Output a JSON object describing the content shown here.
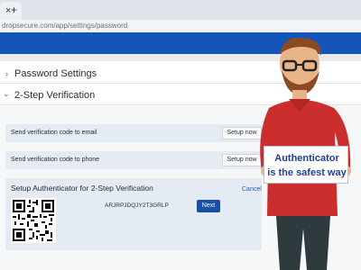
{
  "browser": {
    "tab_close": "×",
    "new_tab": "+",
    "url": "dropsecure.com/app/settings/password"
  },
  "sections": {
    "password_settings": "Password Settings",
    "two_step": "2-Step Verification"
  },
  "verification": {
    "email_label": "Send verification code to email",
    "phone_label": "Send verification code to phone",
    "setup_label": "Setup now"
  },
  "authenticator": {
    "title": "Setup Authenticator for 2-Step Verification",
    "cancel": "Cancel",
    "secret": "ARJRPJDQJY2T3GRLP",
    "next": "Next"
  },
  "sign": {
    "line1": "Authenticator",
    "line2": "is the safest way"
  },
  "icons": {
    "collapsed_chevron": "chevron-right-icon",
    "expanded_chevron": "chevron-down-icon"
  },
  "colors": {
    "header_blue": "#1554b8",
    "row_bg": "#e4ebf3",
    "sign_text": "#1f3f9b"
  }
}
